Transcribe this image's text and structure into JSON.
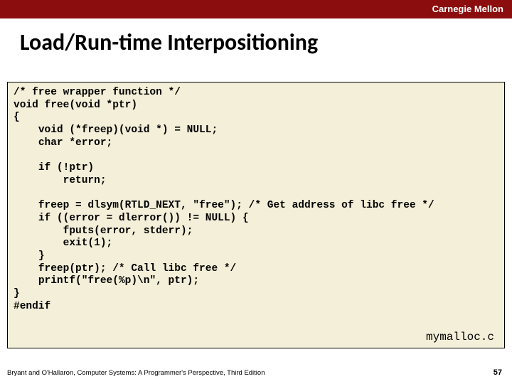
{
  "header": {
    "institution": "Carnegie Mellon"
  },
  "title": "Load/Run-time Interpositioning",
  "code": "/* free wrapper function */\nvoid free(void *ptr)\n{\n    void (*freep)(void *) = NULL;\n    char *error;\n\n    if (!ptr)\n        return;\n\n    freep = dlsym(RTLD_NEXT, \"free\"); /* Get address of libc free */\n    if ((error = dlerror()) != NULL) {\n        fputs(error, stderr);\n        exit(1);\n    }\n    freep(ptr); /* Call libc free */\n    printf(\"free(%p)\\n\", ptr);\n}\n#endif",
  "filename": "mymalloc.c",
  "footer": {
    "citation": "Bryant and O'Hallaron, Computer Systems: A Programmer's Perspective, Third Edition",
    "page": "57"
  }
}
